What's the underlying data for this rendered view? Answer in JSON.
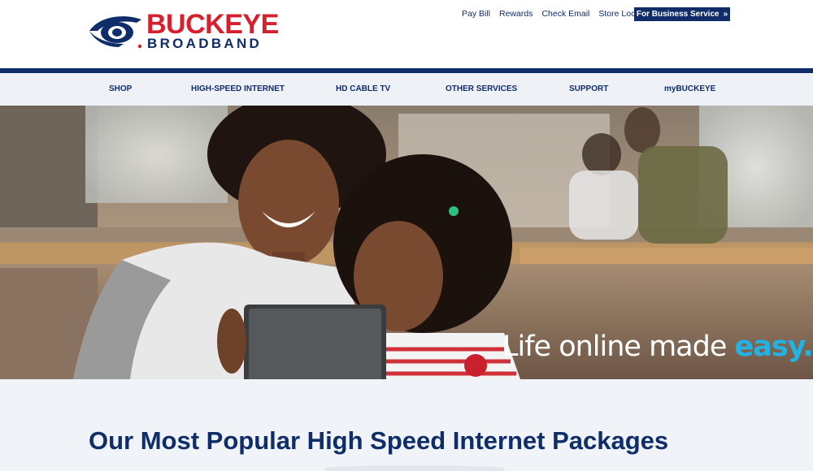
{
  "header": {
    "logo_word": "BUCKEYE",
    "logo_sub": "BROADBAND",
    "utility_links": [
      "Pay Bill",
      "Rewards",
      "Check Email",
      "Store Locator"
    ],
    "business_button": "For Business Service",
    "business_button_icon": "double-chevron-right-icon"
  },
  "main_nav": {
    "items": [
      "SHOP",
      "HIGH-SPEED INTERNET",
      "HD CABLE TV",
      "OTHER SERVICES",
      "SUPPORT",
      "myBUCKEYE"
    ]
  },
  "hero": {
    "tagline_main": "Life online made ",
    "tagline_accent": "easy."
  },
  "packages": {
    "title": "Our Most Popular High Speed Internet Packages"
  },
  "colors": {
    "brand_navy": "#0f2d69",
    "brand_red": "#d6202e",
    "accent_blue": "#22b3e6",
    "nav_background": "#eef1f5"
  }
}
